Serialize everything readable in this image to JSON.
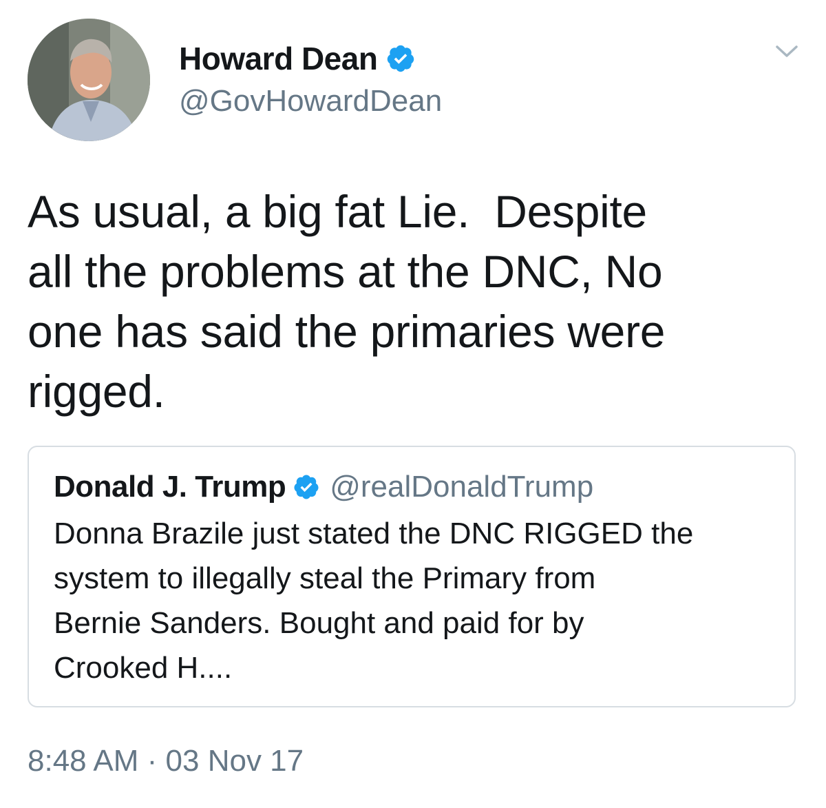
{
  "author": {
    "display_name": "Howard Dean",
    "handle": "@GovHowardDean",
    "verified": true
  },
  "icons": {
    "avatar": "avatar-photo",
    "verified": "verified-badge-icon",
    "menu": "chevron-down-icon"
  },
  "colors": {
    "verified_blue": "#1da1f2",
    "secondary_text": "#657786",
    "primary_text": "#14171a",
    "border": "#d7dde2"
  },
  "tweet": {
    "text": "As usual, a big fat Lie.  Despite\nall the problems at the DNC, No\none has said the primaries were\nrigged.",
    "timestamp": "8:48 AM · 03 Nov 17"
  },
  "quoted_tweet": {
    "display_name": "Donald J. Trump",
    "handle": "@realDonaldTrump",
    "verified": true,
    "text": "Donna Brazile just stated the DNC RIGGED the\nsystem to illegally steal the Primary from\nBernie Sanders. Bought and paid for by\nCrooked H...."
  }
}
